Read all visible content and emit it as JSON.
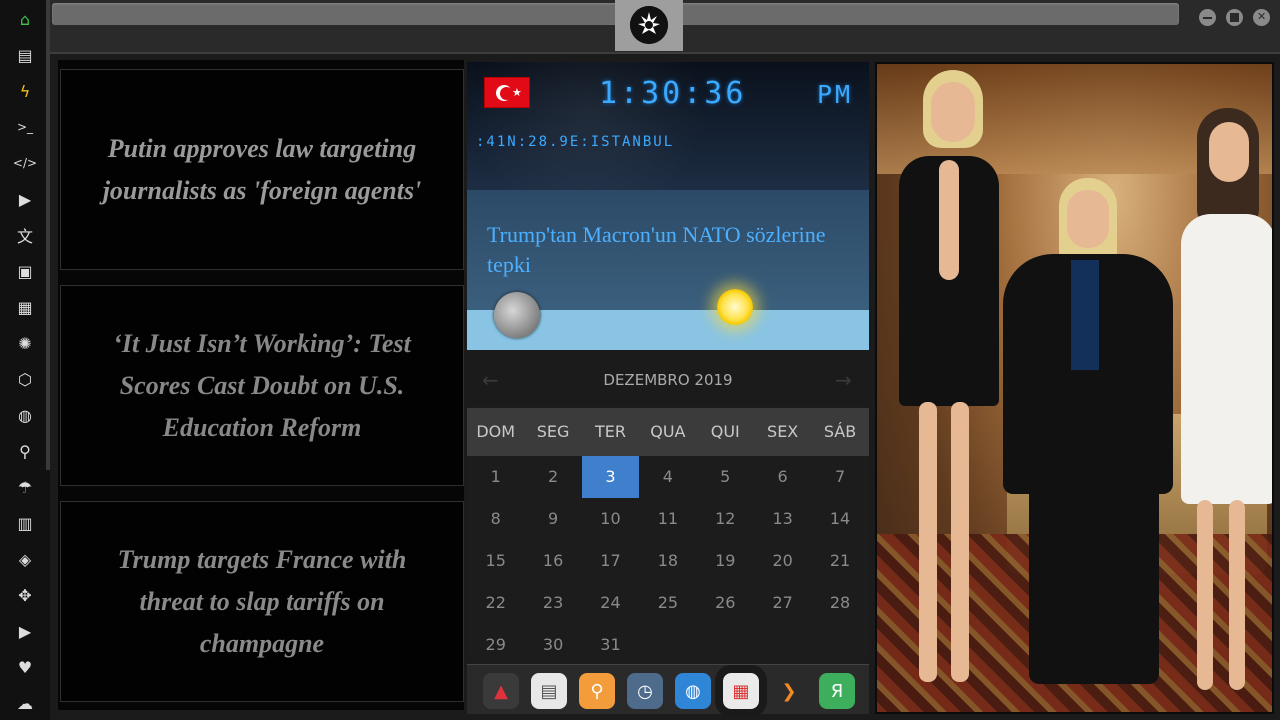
{
  "sidebar": {
    "items": [
      {
        "name": "home-icon",
        "glyph": "⌂",
        "color": "#3ec34a"
      },
      {
        "name": "document-icon",
        "glyph": "▤"
      },
      {
        "name": "flash-icon",
        "glyph": "ϟ",
        "color": "#f0c020"
      },
      {
        "name": "terminal-icon",
        "glyph": ">_"
      },
      {
        "name": "code-icon",
        "glyph": "</>"
      },
      {
        "name": "play-icon",
        "glyph": "▶"
      },
      {
        "name": "translate-icon",
        "glyph": "文"
      },
      {
        "name": "image-icon",
        "glyph": "▣"
      },
      {
        "name": "newspaper-icon",
        "glyph": "▦"
      },
      {
        "name": "aperture-icon",
        "glyph": "✺"
      },
      {
        "name": "hexagon-icon",
        "glyph": "⬡"
      },
      {
        "name": "globe-icon",
        "glyph": "◍"
      },
      {
        "name": "search-icon",
        "glyph": "⚲"
      },
      {
        "name": "umbrella-icon",
        "glyph": "☂"
      },
      {
        "name": "contacts-icon",
        "glyph": "▥"
      },
      {
        "name": "git-icon",
        "glyph": "◈"
      },
      {
        "name": "expand-icon",
        "glyph": "✥"
      },
      {
        "name": "youtube-icon",
        "glyph": "▶"
      },
      {
        "name": "heart-icon",
        "glyph": "♥"
      },
      {
        "name": "cloud-icon",
        "glyph": "☁"
      }
    ]
  },
  "news": [
    {
      "text": "Putin approves law targeting journalists as 'foreign agents'",
      "color": "#9a9a9a"
    },
    {
      "text": "‘It Just Isn’t Working’: Test Scores Cast Doubt on U.S. Education Reform",
      "color": "#888888"
    },
    {
      "text": "Trump targets France with threat to slap tariffs on champagne",
      "color": "#8a8a8a"
    }
  ],
  "clock": {
    "time": "1:30:36",
    "ampm": "PM",
    "location": ":41N:28.9E:ISTANBUL",
    "headline": "Trump'tan Macron'un NATO sözlerine tepki",
    "accent": "#3aa9ff"
  },
  "calendar": {
    "title": "DEZEMBRO 2019",
    "prev": "←",
    "next": "→",
    "weekdays": [
      "DOM",
      "SEG",
      "TER",
      "QUA",
      "QUI",
      "SEX",
      "SÁB"
    ],
    "weeks": [
      [
        "1",
        "2",
        "3",
        "4",
        "5",
        "6",
        "7"
      ],
      [
        "8",
        "9",
        "10",
        "11",
        "12",
        "13",
        "14"
      ],
      [
        "15",
        "16",
        "17",
        "18",
        "19",
        "20",
        "21"
      ],
      [
        "22",
        "23",
        "24",
        "25",
        "26",
        "27",
        "28"
      ],
      [
        "29",
        "30",
        "31",
        "",
        "",
        "",
        ""
      ]
    ],
    "today": "3",
    "today_color": "#3f7fcc"
  },
  "dock": {
    "items": [
      {
        "name": "app-launcher-icon",
        "glyph": "▲",
        "bg": "#3a3a3a",
        "fg": "#e0323c"
      },
      {
        "name": "news-reader-icon",
        "glyph": "▤",
        "bg": "#e8e8e8",
        "fg": "#555"
      },
      {
        "name": "search-app-icon",
        "glyph": "⚲",
        "bg": "#f39c3c",
        "fg": "#fff"
      },
      {
        "name": "clock-app-icon",
        "glyph": "◷",
        "bg": "#4e6b8c",
        "fg": "#fff"
      },
      {
        "name": "browser-icon",
        "glyph": "◍",
        "bg": "#2f86d6",
        "fg": "#fff"
      },
      {
        "name": "calendar-app-icon",
        "glyph": "▦",
        "bg": "#eaeaea",
        "fg": "#d33"
      },
      {
        "name": "next-icon",
        "glyph": "❯",
        "bg": "transparent",
        "fg": "#f08a24"
      },
      {
        "name": "yandex-icon",
        "glyph": "Я",
        "bg": "#3cae5c",
        "fg": "#fff"
      }
    ]
  }
}
